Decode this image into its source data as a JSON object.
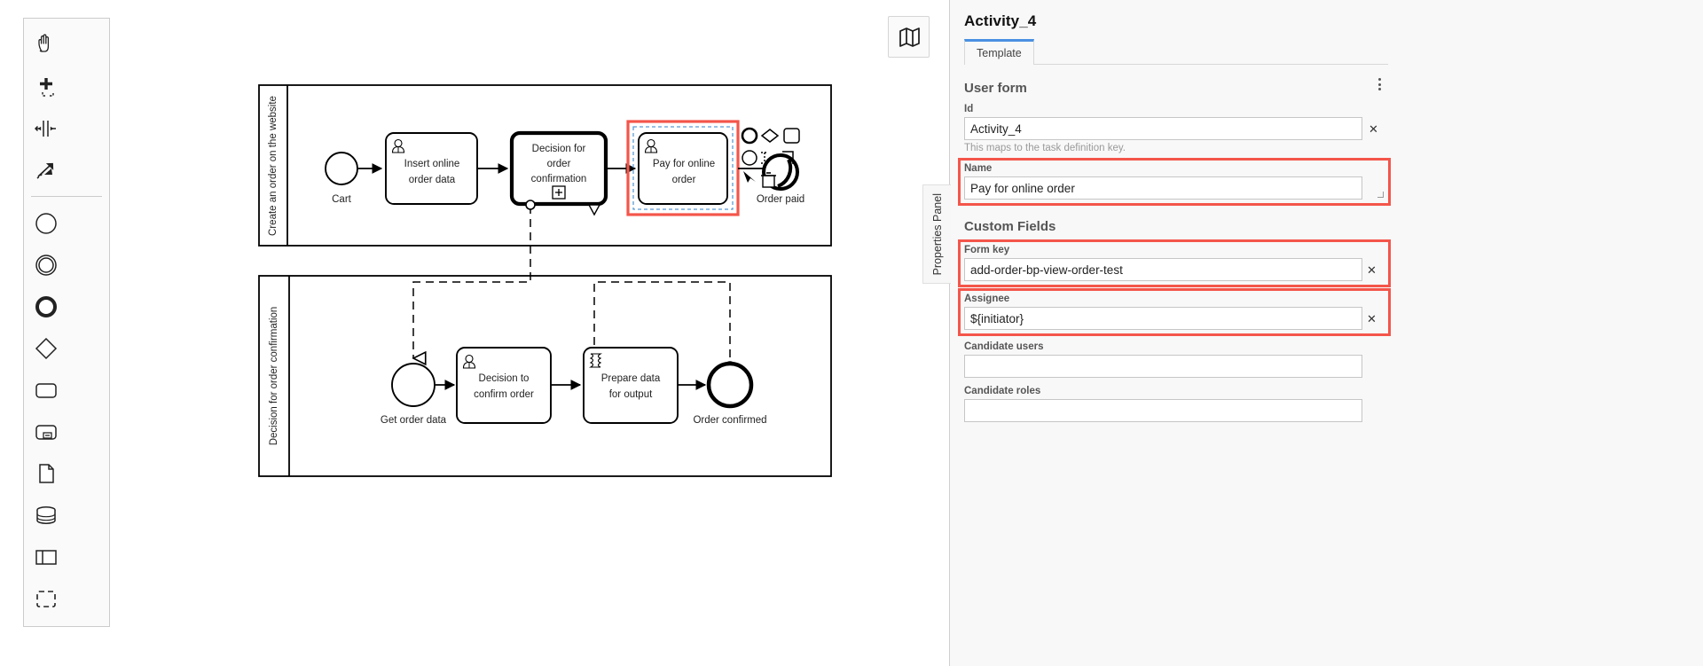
{
  "palette": {
    "tools": [
      {
        "name": "hand-tool",
        "label": "Activate the hand tool"
      },
      {
        "name": "lasso-tool",
        "label": "Activate the lasso tool"
      },
      {
        "name": "space-tool",
        "label": "Activate the create/remove space tool"
      },
      {
        "name": "global-connect-tool",
        "label": "Activate the global connect tool"
      }
    ],
    "elements": [
      {
        "name": "start-event",
        "label": "Create StartEvent"
      },
      {
        "name": "intermediate-event",
        "label": "Create Intermediate/Boundary Event"
      },
      {
        "name": "end-event",
        "label": "Create EndEvent"
      },
      {
        "name": "exclusive-gateway",
        "label": "Create Gateway"
      },
      {
        "name": "task",
        "label": "Create Task"
      },
      {
        "name": "subprocess-expanded",
        "label": "Create expanded SubProcess"
      },
      {
        "name": "data-object",
        "label": "Create DataObjectReference"
      },
      {
        "name": "data-store",
        "label": "Create DataStoreReference"
      },
      {
        "name": "participant",
        "label": "Create Pool/Participant"
      },
      {
        "name": "group",
        "label": "Create Group"
      }
    ]
  },
  "canvas": {
    "minimap_toggle": "toggle-minimap",
    "pools": [
      {
        "name": "pool-create-order",
        "lane_label": "Create an order on the website",
        "elements": [
          {
            "type": "start-event",
            "label": "Cart"
          },
          {
            "type": "user-task",
            "label": "Insert online order data"
          },
          {
            "type": "call-activity",
            "label": "Decision for order confirmation"
          },
          {
            "type": "user-task",
            "label": "Pay for online order",
            "selected": true
          },
          {
            "type": "end-event",
            "label": "Order paid"
          }
        ]
      },
      {
        "name": "pool-decision-confirmation",
        "lane_label": "Decision for order confirmation",
        "elements": [
          {
            "type": "start-event",
            "label": "Get order data"
          },
          {
            "type": "user-task",
            "label": "Decision to confirm order"
          },
          {
            "type": "script-task",
            "label": "Prepare data for output"
          },
          {
            "type": "end-event",
            "label": "Order confirmed"
          }
        ]
      }
    ]
  },
  "properties_panel": {
    "tab_label": "Properties Panel",
    "title": "Activity_4",
    "tabs": [
      {
        "label": "Template",
        "active": true
      }
    ],
    "menu_icon": "kebab-menu-icon",
    "sections": [
      {
        "heading": "User form",
        "fields": [
          {
            "label": "Id",
            "value": "Activity_4",
            "hint": "This maps to the task definition key.",
            "clearable": true,
            "highlighted": false,
            "name": "id-field"
          },
          {
            "label": "Name",
            "value": "Pay for online order",
            "clearable": false,
            "highlighted": true,
            "textarea": true,
            "name": "name-field"
          }
        ]
      },
      {
        "heading": "Custom Fields",
        "fields": [
          {
            "label": "Form key",
            "value": "add-order-bp-view-order-test",
            "clearable": true,
            "highlighted": true,
            "name": "form-key-field"
          },
          {
            "label": "Assignee",
            "value": "${initiator}",
            "clearable": true,
            "highlighted": true,
            "name": "assignee-field"
          },
          {
            "label": "Candidate users",
            "value": "",
            "clearable": false,
            "highlighted": false,
            "name": "candidate-users-field"
          },
          {
            "label": "Candidate roles",
            "value": "",
            "clearable": false,
            "highlighted": false,
            "name": "candidate-roles-field"
          }
        ]
      }
    ],
    "clear_icon": "close-x-icon"
  },
  "colors": {
    "highlight_red": "#f4554a",
    "tab_accent": "#4a90e2",
    "selection_blue": "#5b9bd5",
    "panel_bg": "#f8f8f8"
  }
}
